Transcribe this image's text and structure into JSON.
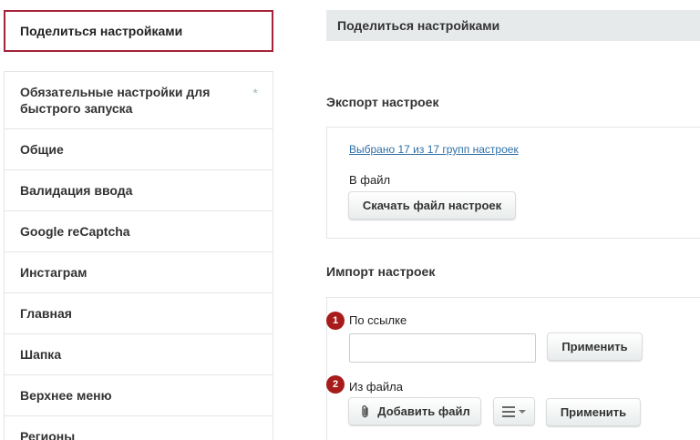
{
  "sidebar": {
    "active_tab": "Поделиться настройками",
    "items": [
      {
        "label": "Обязательные настройки для быстрого запуска",
        "marker": "*"
      },
      {
        "label": "Общие"
      },
      {
        "label": "Валидация ввода"
      },
      {
        "label": "Google reCaptcha"
      },
      {
        "label": "Инстаграм"
      },
      {
        "label": "Главная"
      },
      {
        "label": "Шапка"
      },
      {
        "label": "Верхнее меню"
      },
      {
        "label": "Регионы"
      }
    ]
  },
  "main": {
    "header": "Поделиться настройками",
    "export": {
      "title": "Экспорт настроек",
      "selected_link": "Выбрано 17 из 17 групп настроек",
      "to_file_label": "В файл",
      "download_button": "Скачать файл настроек"
    },
    "import": {
      "title": "Импорт настроек",
      "by_link": {
        "step": "1",
        "label": "По ссылке",
        "value": "",
        "apply_button": "Применить"
      },
      "from_file": {
        "step": "2",
        "label": "Из файла",
        "add_file_button": "Добавить файл",
        "apply_button": "Применить"
      }
    }
  },
  "colors": {
    "accent": "#a5223a",
    "badge": "#a81b1b",
    "link": "#2e6fa7",
    "header_bg": "#e7eaeb"
  }
}
